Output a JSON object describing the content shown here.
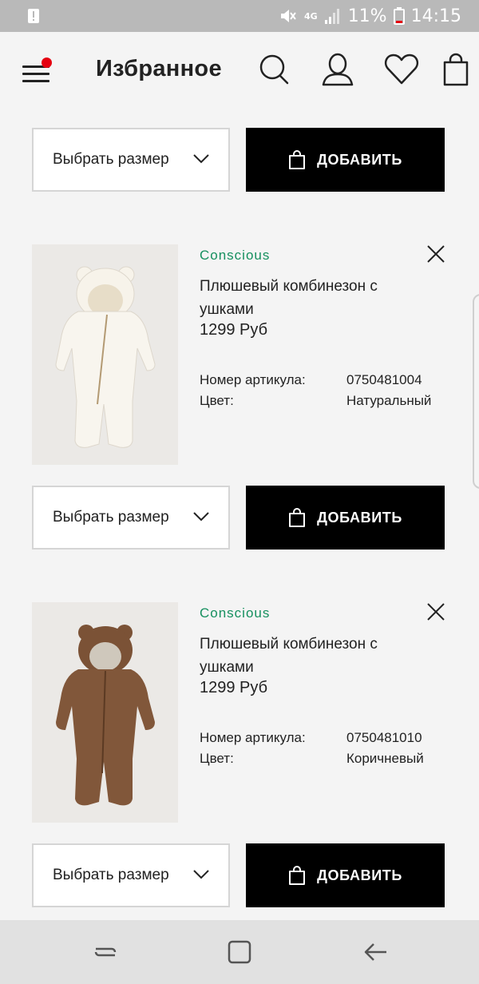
{
  "status_bar": {
    "network": "4G",
    "battery": "11%",
    "time": "14:15"
  },
  "header": {
    "title": "Избранное",
    "icons": [
      "menu-icon",
      "search-icon",
      "account-icon",
      "heart-icon",
      "bag-icon"
    ],
    "notification_dot_color": "#e50010"
  },
  "actions": {
    "size_label": "Выбрать размер",
    "add_label": "ДОБАВИТЬ"
  },
  "products": [
    {
      "tag": "Conscious",
      "name": "Плюшевый комбинезон с ушками",
      "price": "1299 Руб",
      "article_label": "Номер артикула:",
      "article": "0750481004",
      "color_label": "Цвет:",
      "color": "Натуральный"
    },
    {
      "tag": "Conscious",
      "name": "Плюшевый комбинезон с ушками",
      "price": "1299 Руб",
      "article_label": "Номер артикула:",
      "article": "0750481010",
      "color_label": "Цвет:",
      "color": "Коричневый"
    }
  ],
  "colors": {
    "conscious_green": "#16905f",
    "button_black": "#000000"
  },
  "nav": {
    "icons": [
      "recent-apps-icon",
      "home-icon",
      "back-icon"
    ]
  }
}
